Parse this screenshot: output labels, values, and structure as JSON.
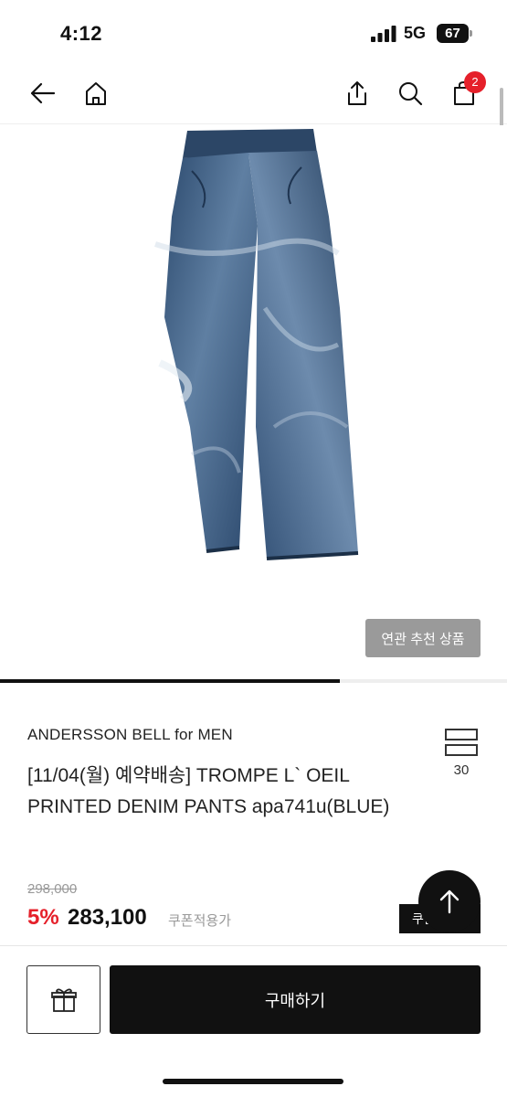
{
  "status_bar": {
    "time": "4:12",
    "network": "5G",
    "battery": "67"
  },
  "nav": {
    "cart_count": "2"
  },
  "gallery": {
    "related_label": "연관 추천 상품",
    "progress_fraction": 0.67
  },
  "product": {
    "brand": "ANDERSSON BELL for MEN",
    "title": "[11/04(월) 예약배송]  TROMPE L` OEIL PRINTED DENIM PANTS apa741u(BLUE)",
    "size_count": "30",
    "original_price": "298,000",
    "discount": "5%",
    "price": "283,100",
    "coupon_note": "쿠폰적용가",
    "coupon_button": "쿠폰"
  },
  "bottom_bar": {
    "buy_label": "구매하기"
  },
  "colors": {
    "accent_red": "#e5202a",
    "primary_black": "#111111",
    "related_gray": "#9a9a9a"
  }
}
